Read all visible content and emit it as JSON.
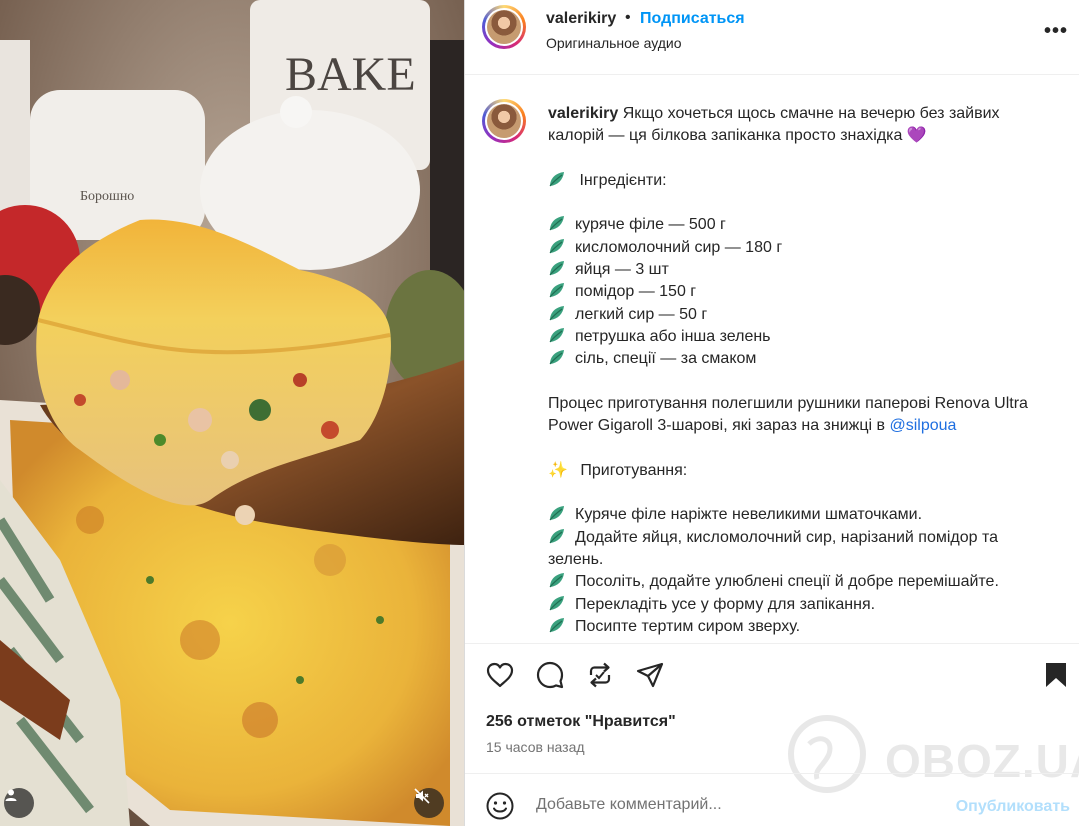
{
  "post": {
    "username": "valerikiry",
    "separator": "•",
    "follow_label": "Подписаться",
    "audio_label": "Оригинальное аудио",
    "more_label": "•••"
  },
  "caption": {
    "username": "valerikiry",
    "intro": "Якщо хочеться щось смачне на вечерю без зайвих калорій — ця білкова запіканка просто знахідка",
    "intro_emoji": "💜",
    "ingredients_title": "Інгредієнти:",
    "ingredients": [
      "куряче філе — 500 г",
      "кисломолочний сир — 180 г",
      "яйця — 3 шт",
      "помідор — 150 г",
      "легкий сир — 50 г",
      "петрушка або інша зелень",
      "сіль, спеції — за смаком"
    ],
    "process_text": "Процес приготування полегшили рушники паперові Renova Ultra Power Gigaroll 3-шарові, які зараз на знижці в",
    "mention": "@silpoua",
    "sparkle_emoji": "✨",
    "cooking_title": "Приготування:",
    "steps": [
      "Куряче філе наріжте невеликими шматочками.",
      "Додайте яйця, кисломолочний сир, нарізаний помідор та зелень.",
      "Посоліть, додайте улюблені спеції й добре перемішайте.",
      "Перекладіть усе у форму для запікання.",
      "Посипте тертим сиром зверху."
    ]
  },
  "actions": {
    "like_icon": "heart-icon",
    "comment_icon": "comment-icon",
    "repost_icon": "repost-icon",
    "share_icon": "share-icon",
    "save_icon": "bookmark-icon"
  },
  "likes_text": "256 отметок \"Нравится\"",
  "time_text": "15 часов назад",
  "comment": {
    "placeholder": "Добавьте комментарий...",
    "post_label": "Опубликовать"
  },
  "watermark": "OBOZ.UA",
  "media": {
    "jar_label": "BAKE",
    "crock_label": "Борошно"
  },
  "colors": {
    "accent": "#0095f6",
    "post_disabled": "#b2dffc",
    "mention": "#1f6fe0",
    "leaf": "#3aa17e"
  }
}
